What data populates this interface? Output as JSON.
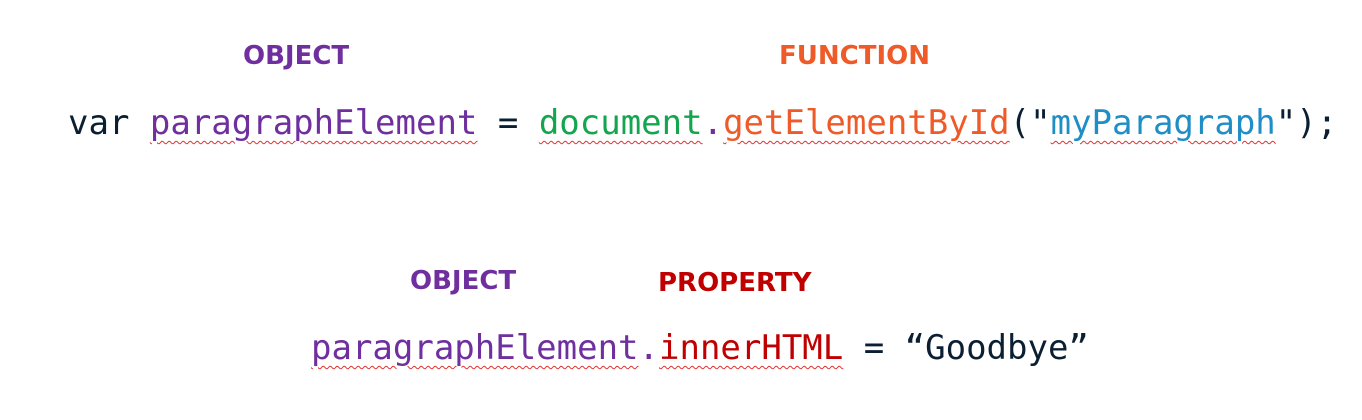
{
  "colors": {
    "object": "#6f2f9f",
    "function": "#ee5a28",
    "property": "#c00000",
    "document": "#14a54f",
    "string": "#1f8ec7",
    "plain": "#0b1f33"
  },
  "labels": {
    "object_1": "OBJECT",
    "function": "FUNCTION",
    "object_2": "OBJECT",
    "property": "PROPERTY"
  },
  "line1": {
    "keyword": "var ",
    "variable": "paragraphElement",
    "assign": " = ",
    "object": "document",
    "dot": ".",
    "method": "getElementById",
    "open": "(\"",
    "argument": "myParagraph",
    "close": "\");"
  },
  "line2": {
    "object": "paragraphElement",
    "dot": ".",
    "property": "innerHTML",
    "assign": " = ",
    "value": "“Goodbye”"
  }
}
